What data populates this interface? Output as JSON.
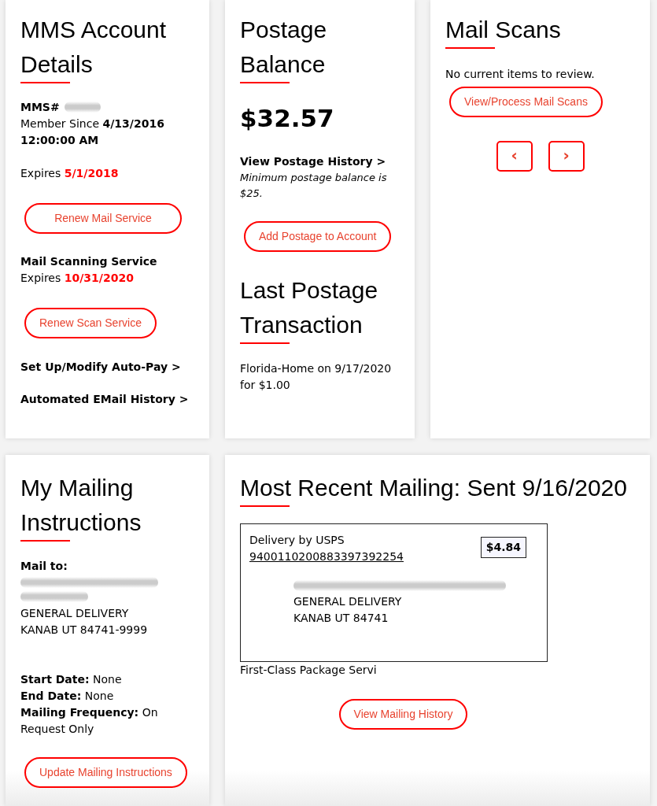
{
  "account_card": {
    "title": "MMS Account Details",
    "member_number": {
      "label": "MMS#",
      "redacted": true
    },
    "member_since": "Member Since **4/13/2016 12:00:00 AM**",
    "mail_expiry": "Expires **5/1/2018**",
    "renew_mail_button": "Renew Mail Service",
    "scan_service": {
      "title": "Mail Scanning Service",
      "expiry": "Expires **10/31/2020**"
    },
    "renew_scan_button": "Renew Scan Service",
    "links": [
      "Set Up/Modify Auto-Pay >",
      "Automated EMail History >"
    ]
  },
  "postage_card": {
    "title": "Postage Balance",
    "balance": "$32.57",
    "history_link": "View Postage History >",
    "note": "Minimum postage balance is $25.",
    "add_button": "Add Postage to Account",
    "last_transaction": {
      "title": "Last Postage Transaction",
      "text": "Florida-Home on 9/17/2020 for $1.00"
    }
  },
  "scans_card": {
    "title": "Mail Scans",
    "message": "No current items to review.",
    "process_button": "View/Process Mail Scans",
    "pager": [
      "‹",
      "›"
    ]
  },
  "instructions_card": {
    "title": "My Mailing Instructions",
    "mail_to": {
      "label": "Mail to:",
      "recipient_redacted": true,
      "address_lines": [
        "GENERAL DELIVERY",
        "KANAB UT 84741-9999"
      ]
    },
    "details": [
      "**Start Date:** None",
      "**End Date:** None",
      "**Mailing Frequency:** On Request Only"
    ],
    "update_button": "Update Mailing Instructions"
  },
  "recent_mailing_card": {
    "title": "Most Recent Mailing: Sent 9/16/2020",
    "label": {
      "carrier": "Delivery by USPS",
      "tracking_number": "9400110200883397392254",
      "postage": "$4.84",
      "recipient_redacted": true,
      "address_lines": [
        "GENERAL DELIVERY",
        "KANAB UT 84741"
      ]
    },
    "service": "First-Class Package Servi",
    "history_button": "View Mailing History"
  }
}
